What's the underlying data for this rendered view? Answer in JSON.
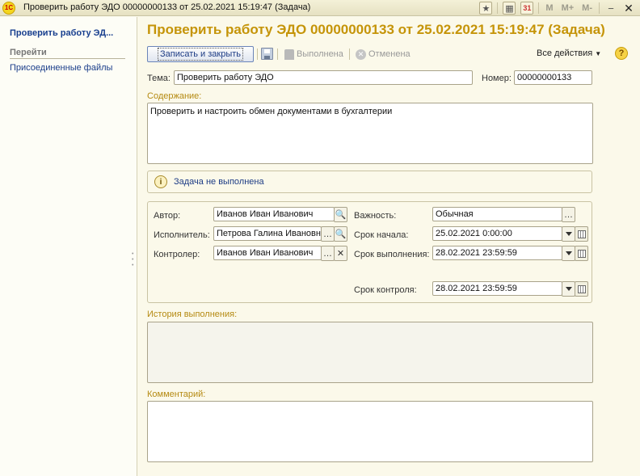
{
  "window": {
    "app_icon_text": "1С",
    "title": "Проверить работу ЭДО 00000000133 от 25.02.2021 15:19:47 (Задача)",
    "memory_buttons": [
      "M",
      "M+",
      "M-"
    ]
  },
  "sidebar": {
    "title": "Проверить работу ЭД...",
    "section": "Перейти",
    "links": [
      "Присоединенные файлы"
    ]
  },
  "form": {
    "title": "Проверить работу ЭДО 00000000133 от 25.02.2021 15:19:47 (Задача)",
    "toolbar": {
      "save_close": "Записать и закрыть",
      "done": "Выполнена",
      "cancelled": "Отменена",
      "all_actions": "Все действия",
      "help": "?"
    },
    "subject_label": "Тема:",
    "subject_value": "Проверить работу ЭДО",
    "number_label": "Номер:",
    "number_value": "00000000133",
    "content_label": "Содержание:",
    "content_value": "Проверить и настроить обмен документами в бухгалтерии",
    "status_text": "Задача не выполнена",
    "author_label": "Автор:",
    "author_value": "Иванов Иван Иванович",
    "executor_label": "Исполнитель:",
    "executor_value": "Петрова Галина Ивановна",
    "controller_label": "Контролер:",
    "controller_value": "Иванов Иван Иванович",
    "importance_label": "Важность:",
    "importance_value": "Обычная",
    "start_label": "Срок начала:",
    "start_value": "25.02.2021  0:00:00",
    "due_label": "Срок выполнения:",
    "due_value": "28.02.2021 23:59:59",
    "control_label": "Срок контроля:",
    "control_value": "28.02.2021 23:59:59",
    "history_label": "История выполнения:",
    "comment_label": "Комментарий:"
  }
}
